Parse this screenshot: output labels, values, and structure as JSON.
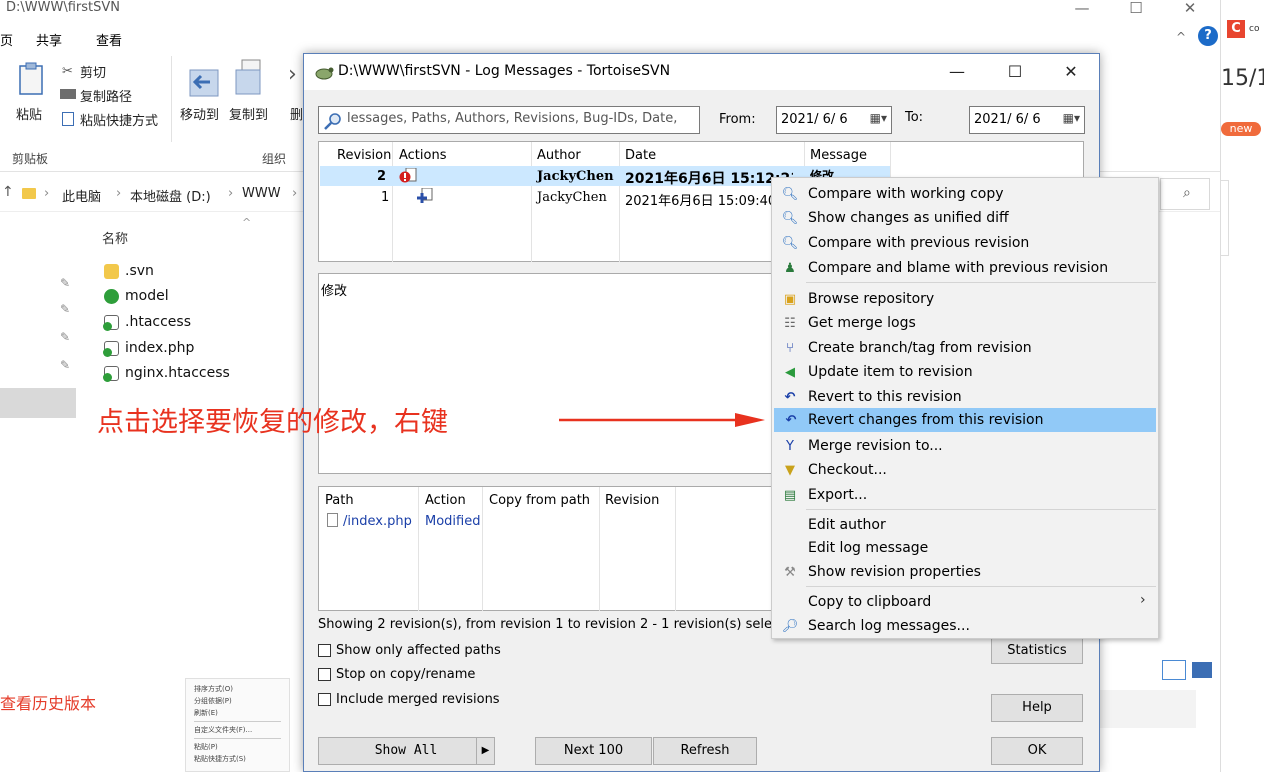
{
  "explorer": {
    "title": "D:\\WWW\\firstSVN",
    "tabs": [
      "页",
      "共享",
      "查看"
    ],
    "ribbon": {
      "cut": "剪切",
      "copy_path": "复制路径",
      "paste": "粘贴",
      "paste_shortcut": "粘贴快捷方式",
      "move_to": "移动到",
      "copy_to": "复制到",
      "delete_partial": "删",
      "clipboard_group": "剪贴板",
      "organize_group": "组织"
    },
    "breadcrumb": [
      "此电脑",
      "本地磁盘 (D:)",
      "WWW"
    ],
    "column_name": "名称",
    "files": [
      ".svn",
      "model",
      ".htaccess",
      "index.php",
      "nginx.htaccess"
    ],
    "history_label": "查看历史版本",
    "small_menu": [
      "排序方式(O)",
      "分组依据(P)",
      "刷新(E)",
      "自定义文件夹(F)...",
      "粘贴(P)",
      "粘贴快捷方式(S)"
    ]
  },
  "browser_edge": {
    "top_text": "C",
    "big_text": "15/1",
    "badge": "new"
  },
  "dialog": {
    "title": "D:\\WWW\\firstSVN - Log Messages - TortoiseSVN",
    "filter_placeholder": "lessages, Paths, Authors, Revisions, Bug-IDs, Date,",
    "from_label": "From:",
    "from_date": "2021/ 6/ 6",
    "to_label": "To:",
    "to_date": "2021/ 6/ 6",
    "rev_headers": [
      "Revision",
      "Actions",
      "Author",
      "Date",
      "Message"
    ],
    "revisions": [
      {
        "revision": "2",
        "author": "JackyChen",
        "date": "2021年6月6日 15:12:21",
        "message": "修改"
      },
      {
        "revision": "1",
        "author": "JackyChen",
        "date": "2021年6月6日 15:09:40",
        "message": ""
      }
    ],
    "message_text": "修改",
    "path_headers": [
      "Path",
      "Action",
      "Copy from path",
      "Revision"
    ],
    "paths": [
      {
        "path": "/index.php",
        "action": "Modified"
      }
    ],
    "status": "Showing 2 revision(s), from revision 1 to revision 2 - 1 revision(s) selected",
    "checkboxes": [
      "Show only affected paths",
      "Stop on copy/rename",
      "Include merged revisions"
    ],
    "buttons": {
      "statistics": "Statistics",
      "help": "Help",
      "show_all": "Show All",
      "next100": "Next 100",
      "refresh": "Refresh",
      "ok": "OK"
    }
  },
  "context_menu": {
    "items": [
      "Compare with working copy",
      "Show changes as unified diff",
      "Compare with previous revision",
      "Compare and blame with previous revision",
      "Browse repository",
      "Get merge logs",
      "Create branch/tag from revision",
      "Update item to revision",
      "Revert to this revision",
      "Revert changes from this revision",
      "Merge revision to...",
      "Checkout...",
      "Export...",
      "Edit author",
      "Edit log message",
      "Show revision properties",
      "Copy to clipboard",
      "Search log messages..."
    ],
    "highlighted": "Revert changes from this revision"
  },
  "annotation": {
    "text": "点击选择要恢复的修改，右键",
    "color": "#e8321f"
  }
}
